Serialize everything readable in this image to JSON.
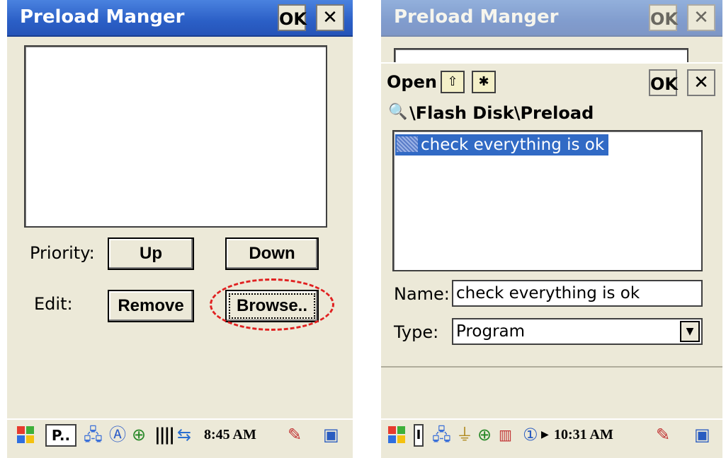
{
  "left": {
    "title": "Preload Manger",
    "ok_label": "OK",
    "close_label": "✕",
    "priority_label": "Priority:",
    "up_label": "Up",
    "down_label": "Down",
    "edit_label": "Edit:",
    "remove_label": "Remove",
    "browse_label": "Browse..",
    "taskbar": {
      "start_icon": "windows-flag-icon",
      "app_label": "P..",
      "clock": "8:45 AM"
    }
  },
  "right": {
    "title": "Preload Manger",
    "ok_label": "OK",
    "close_label": "✕",
    "dialog": {
      "title": "Open",
      "ok_label": "OK",
      "close_label": "✕",
      "path": "\\Flash Disk\\Preload",
      "files": [
        "check everything is ok"
      ],
      "name_label": "Name:",
      "name_value": "check everything is ok",
      "type_label": "Type:",
      "type_value": "Program"
    },
    "taskbar": {
      "start_icon": "windows-flag-icon",
      "app_label": "I",
      "clock": "10:31 AM"
    }
  },
  "colors": {
    "titlebar": "#2b5fc6",
    "selection": "#316ac5",
    "highlight": "#e02020"
  }
}
